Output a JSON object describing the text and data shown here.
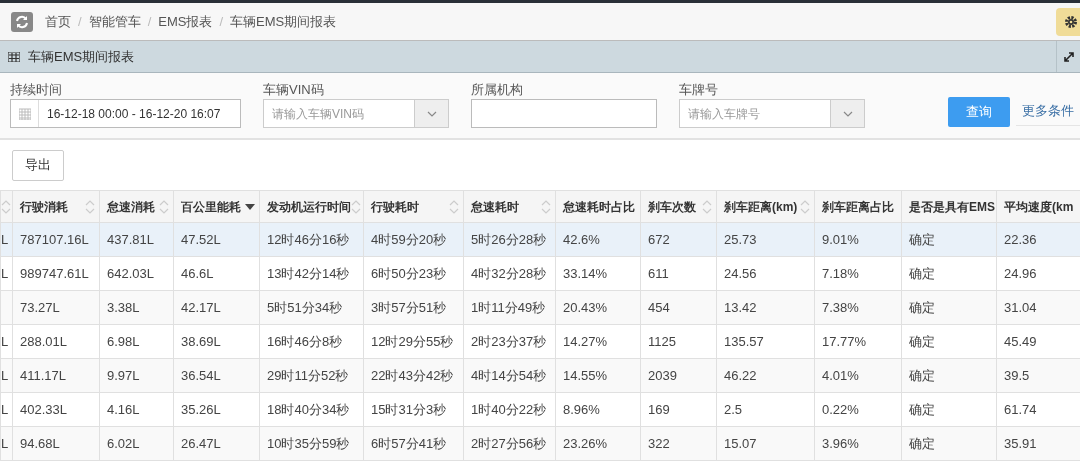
{
  "breadcrumb": [
    {
      "label": "首页"
    },
    {
      "separator": "/",
      "label": "智能管车"
    },
    {
      "separator": "/",
      "label": "EMS报表"
    },
    {
      "separator": "/",
      "label": "车辆EMS期间报表"
    }
  ],
  "panel": {
    "title": "车辆EMS期间报表"
  },
  "filters": [
    {
      "kind": "date",
      "label": "持续时间",
      "value": "16-12-18 00:00 - 16-12-20 16:07"
    },
    {
      "kind": "select",
      "label": "车辆VIN码",
      "placeholder": "请输入车辆VIN码"
    },
    {
      "kind": "text",
      "label": "所属机构"
    },
    {
      "kind": "select",
      "label": "车牌号",
      "placeholder": "请输入车牌号"
    }
  ],
  "query_button": "查询",
  "more_button": "更多条件",
  "export_button": "导出",
  "table": {
    "columns": [
      {
        "sortable": true,
        "sorted": false
      },
      {
        "label": "行驶消耗",
        "sortable": true,
        "sorted": false
      },
      {
        "label": "怠速消耗",
        "sortable": true,
        "sorted": false
      },
      {
        "label": "百公里能耗",
        "sortable": true,
        "sorted": true
      },
      {
        "label": "发动机运行时间",
        "sortable": true,
        "sorted": false
      },
      {
        "label": "行驶耗时",
        "sortable": true,
        "sorted": false
      },
      {
        "label": "怠速耗时",
        "sortable": true,
        "sorted": false
      },
      {
        "label": "怠速耗时占比",
        "sortable": false,
        "sorted": false
      },
      {
        "label": "刹车次数",
        "sortable": true,
        "sorted": false
      },
      {
        "label": "刹车距离(km)",
        "sortable": true,
        "sorted": false
      },
      {
        "label": "刹车距离占比",
        "sortable": false,
        "sorted": false
      },
      {
        "label": "是否是具有EMS",
        "sortable": false,
        "sorted": false
      },
      {
        "label": "平均速度(km",
        "sortable": false,
        "sorted": false
      }
    ],
    "rows": [
      {
        "selected": true,
        "cells": [
          "L",
          "787107.16L",
          "437.81L",
          "47.52L",
          "12时46分16秒",
          "4时59分20秒",
          "5时26分28秒",
          "42.6%",
          "672",
          "25.73",
          "9.01%",
          "确定",
          "22.36"
        ]
      },
      {
        "selected": false,
        "cells": [
          "L",
          "989747.61L",
          "642.03L",
          "46.6L",
          "13时42分14秒",
          "6时50分23秒",
          "4时32分28秒",
          "33.14%",
          "611",
          "24.56",
          "7.18%",
          "确定",
          "24.96"
        ]
      },
      {
        "selected": false,
        "cells": [
          null,
          "73.27L",
          "3.38L",
          "42.17L",
          "5时51分34秒",
          "3时57分51秒",
          "1时11分49秒",
          "20.43%",
          "454",
          "13.42",
          "7.38%",
          "确定",
          "31.04"
        ]
      },
      {
        "selected": false,
        "cells": [
          "L",
          "288.01L",
          "6.98L",
          "38.69L",
          "16时46分8秒",
          "12时29分55秒",
          "2时23分37秒",
          "14.27%",
          "1125",
          "135.57",
          "17.77%",
          "确定",
          "45.49"
        ]
      },
      {
        "selected": false,
        "cells": [
          "L",
          "411.17L",
          "9.97L",
          "36.54L",
          "29时11分52秒",
          "22时43分42秒",
          "4时14分54秒",
          "14.55%",
          "2039",
          "46.22",
          "4.01%",
          "确定",
          "39.5"
        ]
      },
      {
        "selected": false,
        "cells": [
          "L",
          "402.33L",
          "4.16L",
          "35.26L",
          "18时40分34秒",
          "15时31分3秒",
          "1时40分22秒",
          "8.96%",
          "169",
          "2.5",
          "0.22%",
          "确定",
          "61.74"
        ]
      },
      {
        "selected": false,
        "cells": [
          "L",
          "94.68L",
          "6.02L",
          "26.47L",
          "10时35分59秒",
          "6时57分41秒",
          "2时27分56秒",
          "23.26%",
          "322",
          "15.07",
          "3.96%",
          "确定",
          "35.91"
        ]
      }
    ]
  }
}
